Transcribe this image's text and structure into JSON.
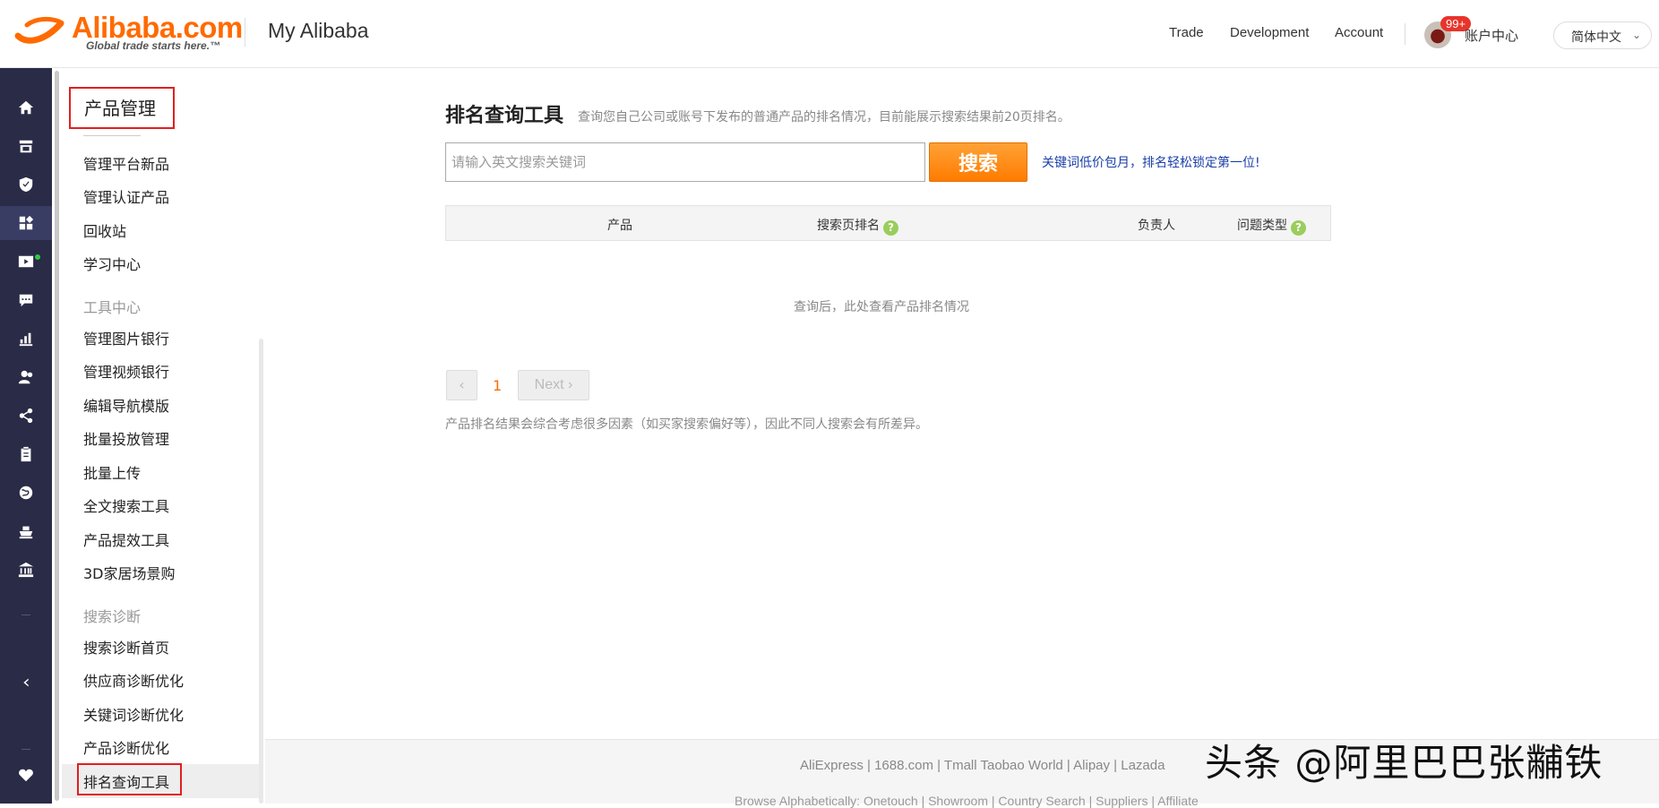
{
  "header": {
    "logo_word": "Alibaba.com",
    "logo_tagline": "Global trade starts here.™",
    "title": "My Alibaba",
    "nav": [
      "Trade",
      "Development",
      "Account"
    ],
    "badge": "99+",
    "account_center": "账户中心",
    "language": "简体中文",
    "language_chevron": "⌄"
  },
  "rail": {
    "items": [
      "home-icon",
      "store-icon",
      "shield-icon",
      "products-icon",
      "video-icon",
      "message-icon",
      "chart-icon",
      "customers-icon",
      "share-icon",
      "clipboard-icon",
      "globe-icon",
      "ship-icon",
      "bank-icon",
      "collapse-icon",
      "heart-icon"
    ],
    "active": "products-icon",
    "colors": {
      "background": "#2a2b47",
      "active": "#3a3d63",
      "dot": "#2ecc40"
    }
  },
  "sidemenu": {
    "title": "产品管理",
    "items_top": [
      "管理平台新品",
      "管理认证产品",
      "回收站",
      "学习中心"
    ],
    "group_tools": "工具中心",
    "items_tools": [
      "管理图片银行",
      "管理视频银行",
      "编辑导航模版",
      "批量投放管理",
      "批量上传",
      "全文搜索工具",
      "产品提效工具",
      "3D家居场景购"
    ],
    "group_diag": "搜索诊断",
    "items_diag": [
      "搜索诊断首页",
      "供应商诊断优化",
      "关键词诊断优化",
      "产品诊断优化",
      "排名查询工具"
    ]
  },
  "main": {
    "title": "排名查询工具",
    "description": "查询您自己公司或账号下发布的普通产品的排名情况，目前能展示搜索结果前20页排名。",
    "search_placeholder": "请输入英文搜索关键词",
    "search_button": "搜索",
    "promo_link": "关键词低价包月，排名轻松锁定第一位!",
    "table_headers": [
      "产品",
      "搜索页排名",
      "负责人",
      "问题类型"
    ],
    "help_mark": "?",
    "empty_text": "查询后，此处查看产品排名情况",
    "pagination": {
      "prev": "‹",
      "current": "1",
      "next": "Next ›"
    },
    "disclaimer": "产品排名结果会综合考虑很多因素（如买家搜索偏好等），因此不同人搜索会有所差异。",
    "accent_color": "#ff6a00"
  },
  "footer": {
    "links": "AliExpress | 1688.com | Tmall Taobao World | Alipay | Lazada",
    "links2": "Browse Alphabetically: Onetouch | Showroom | Country Search | Suppliers | Affiliate"
  },
  "watermark": "头条 @阿里巴巴张黼铁"
}
